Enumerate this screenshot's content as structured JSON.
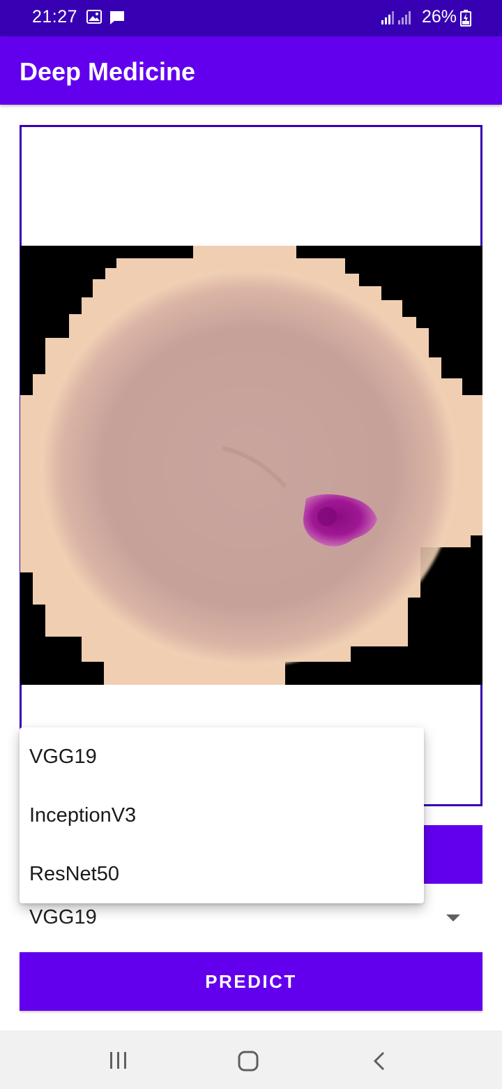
{
  "status_bar": {
    "time": "21:27",
    "battery": "26%",
    "icons": [
      "gallery-icon",
      "message-icon",
      "signal-icon",
      "signal-icon-2",
      "battery-charging-icon"
    ]
  },
  "app_bar": {
    "title": "Deep Medicine"
  },
  "image_view": {
    "content": "blood-cell-image",
    "accent_color": "#3700B3"
  },
  "model_spinner": {
    "selected": "VGG19",
    "options": [
      "VGG19",
      "InceptionV3",
      "ResNet50"
    ]
  },
  "predict_button": {
    "label": "PREDICT"
  },
  "colors": {
    "primary": "#6200EE",
    "primary_dark": "#3700B3",
    "cell": "#c39e99",
    "parasite": "#9c1590",
    "cell_edge": "#f2d3b6"
  },
  "nav_bar": {
    "icons": [
      "recents-icon",
      "home-icon",
      "back-icon"
    ]
  }
}
